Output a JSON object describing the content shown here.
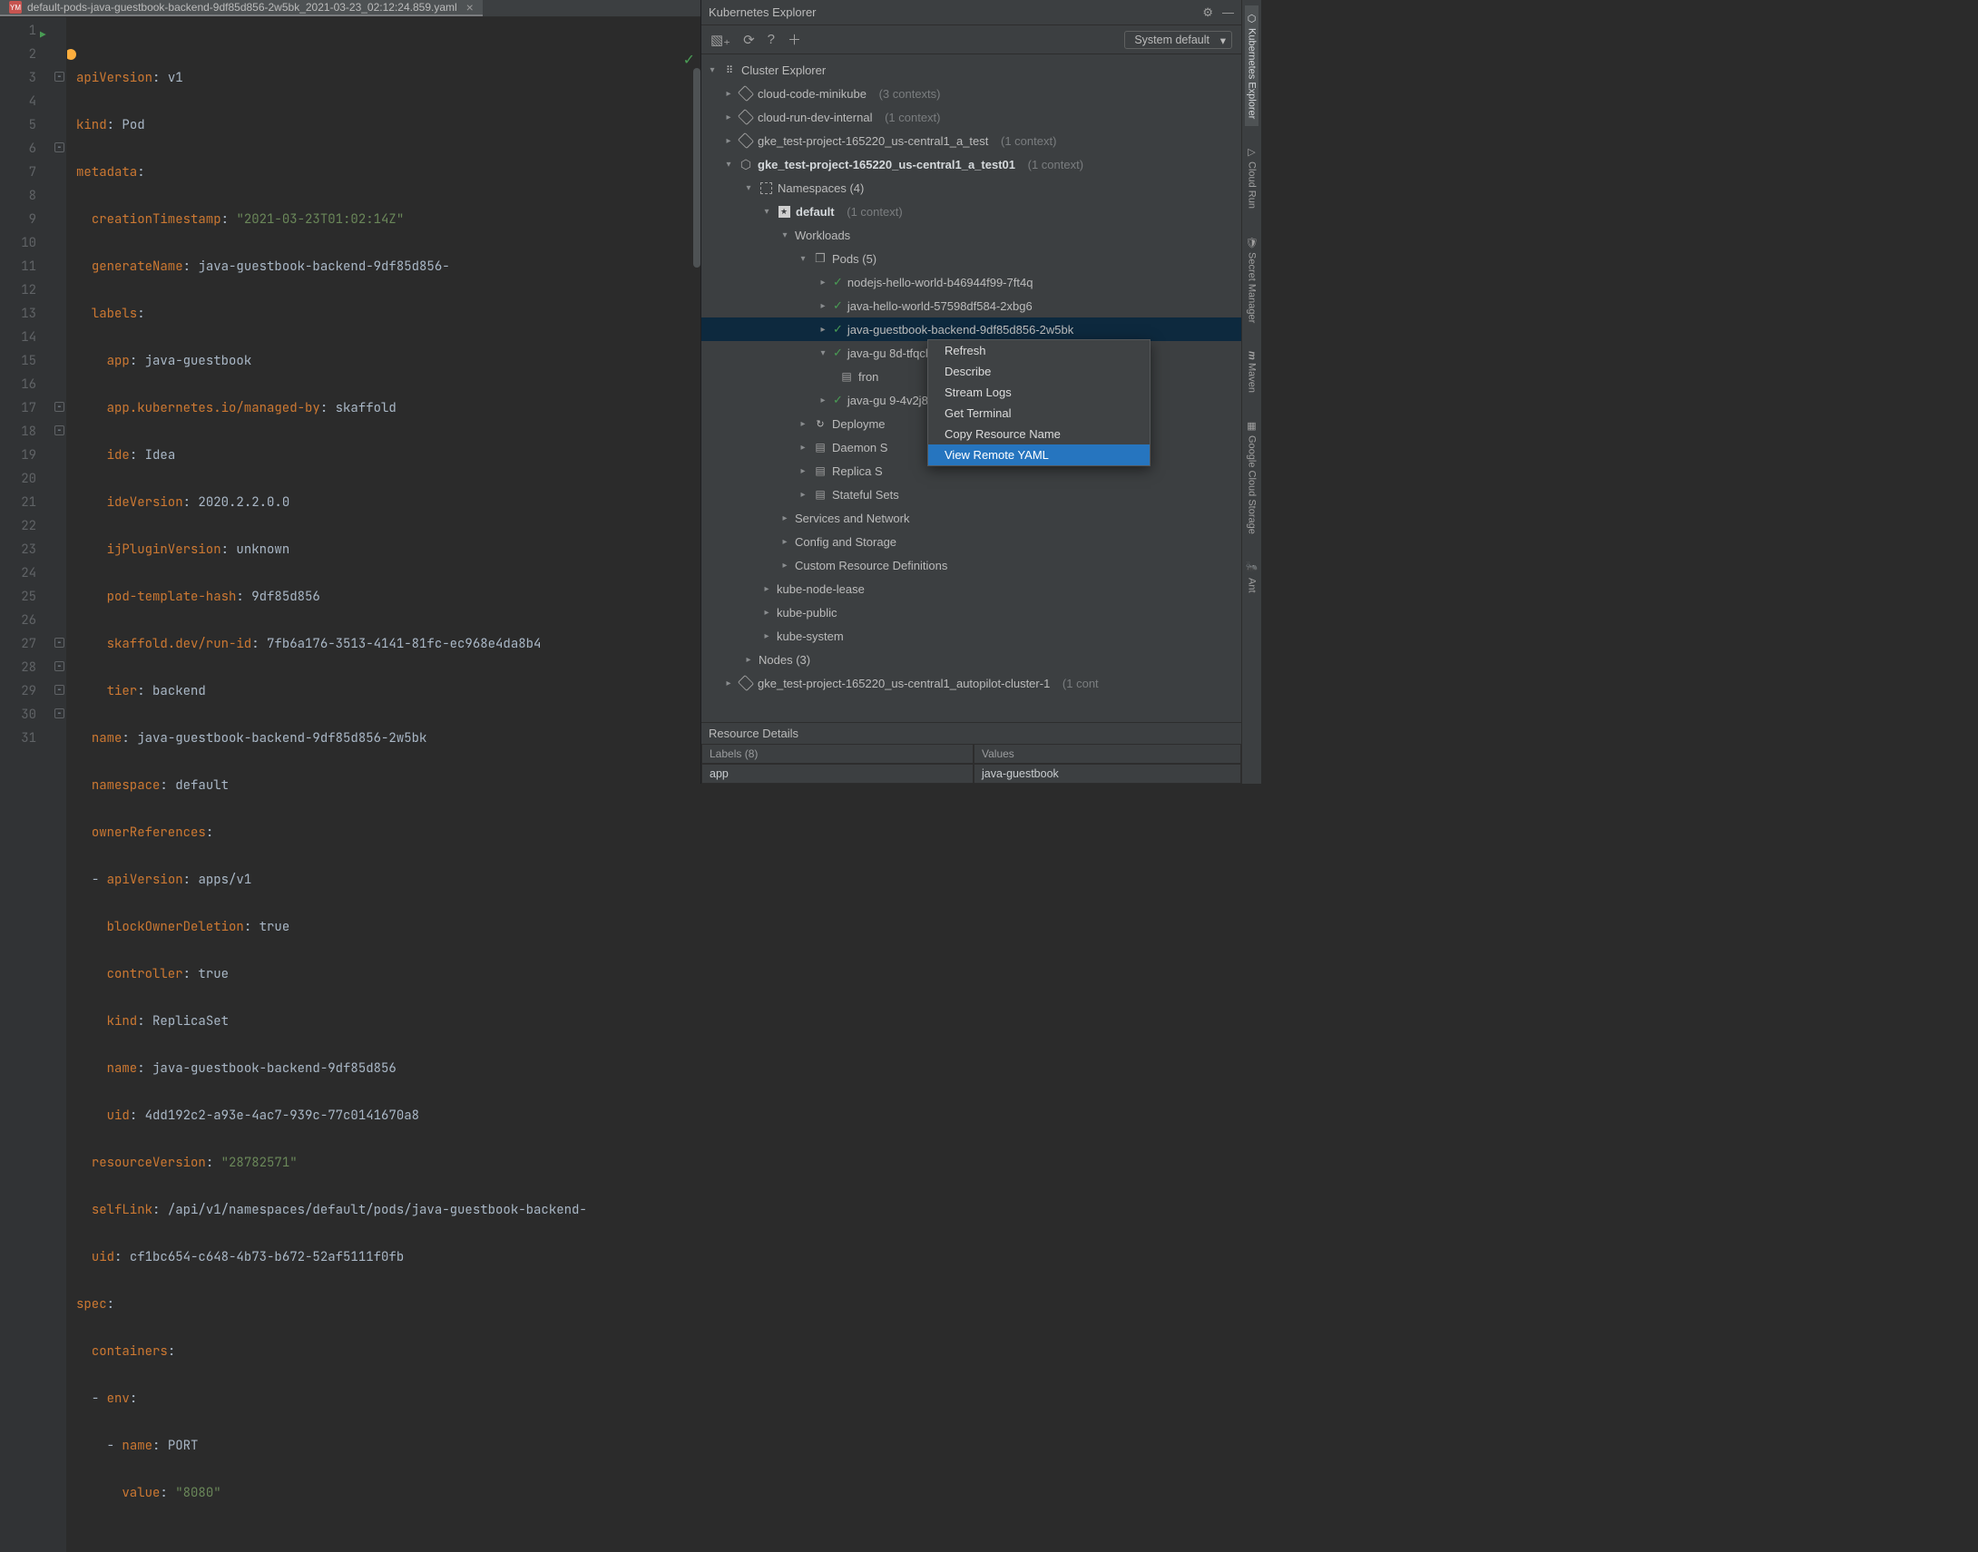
{
  "tab": {
    "filename": "default-pods-java-guestbook-backend-9df85d856-2w5bk_2021-03-23_02:12:24.859.yaml",
    "icon_label": "YM"
  },
  "gutter_lines": [
    "1",
    "2",
    "3",
    "4",
    "5",
    "6",
    "7",
    "8",
    "9",
    "10",
    "11",
    "12",
    "13",
    "14",
    "15",
    "16",
    "17",
    "18",
    "19",
    "20",
    "21",
    "22",
    "23",
    "24",
    "25",
    "26",
    "27",
    "28",
    "29",
    "30",
    "31"
  ],
  "code": {
    "l1_k": "apiVersion",
    "l1_v": "v1",
    "l2_k": "kind",
    "l2_v": "Pod",
    "l3_k": "metadata",
    "l4_k": "creationTimestamp",
    "l4_v": "\"2021-03-23T01:02:14Z\"",
    "l5_k": "generateName",
    "l5_v": "java-guestbook-backend-9df85d856-",
    "l6_k": "labels",
    "l7_k": "app",
    "l7_v": "java-guestbook",
    "l8_k": "app.kubernetes.io/managed-by",
    "l8_v": "skaffold",
    "l9_k": "ide",
    "l9_v": "Idea",
    "l10_k": "ideVersion",
    "l10_v": "2020.2.2.0.0",
    "l11_k": "ijPluginVersion",
    "l11_v": "unknown",
    "l12_k": "pod-template-hash",
    "l12_v": "9df85d856",
    "l13_k": "skaffold.dev/run-id",
    "l13_v": "7fb6a176-3513-4141-81fc-ec968e4da8b4",
    "l14_k": "tier",
    "l14_v": "backend",
    "l15_k": "name",
    "l15_v": "java-guestbook-backend-9df85d856-2w5bk",
    "l16_k": "namespace",
    "l16_v": "default",
    "l17_k": "ownerReferences",
    "l18_k": "apiVersion",
    "l18_v": "apps/v1",
    "l19_k": "blockOwnerDeletion",
    "l19_v": "true",
    "l20_k": "controller",
    "l20_v": "true",
    "l21_k": "kind",
    "l21_v": "ReplicaSet",
    "l22_k": "name",
    "l22_v": "java-guestbook-backend-9df85d856",
    "l23_k": "uid",
    "l23_v": "4dd192c2-a93e-4ac7-939c-77c0141670a8",
    "l24_k": "resourceVersion",
    "l24_v": "\"28782571\"",
    "l25_k": "selfLink",
    "l25_v": "/api/v1/namespaces/default/pods/java-guestbook-backend-",
    "l26_k": "uid",
    "l26_v": "cf1bc654-c648-4b73-b672-52af5111f0fb",
    "l27_k": "spec",
    "l28_k": "containers",
    "l29_k": "env",
    "l30_k": "name",
    "l30_v": "PORT",
    "l31_k": "value",
    "l31_v": "\"8080\""
  },
  "explorer": {
    "title": "Kubernetes Explorer",
    "dropdown": "System default",
    "root": "Cluster Explorer",
    "clusters": [
      {
        "name": "cloud-code-minikube",
        "ctx": "(3 contexts)"
      },
      {
        "name": "cloud-run-dev-internal",
        "ctx": "(1 context)"
      },
      {
        "name": "gke_test-project-165220_us-central1_a_test",
        "ctx": "(1 context)"
      }
    ],
    "activeCluster": {
      "name": "gke_test-project-165220_us-central1_a_test01",
      "ctx": "(1 context)"
    },
    "namespaces_label": "Namespaces (4)",
    "default_ns": "default",
    "default_ctx": "(1 context)",
    "workloads": "Workloads",
    "pods_label": "Pods (5)",
    "pods": [
      "nodejs-hello-world-b46944f99-7ft4q",
      "java-hello-world-57598df584-2xbg6",
      "java-guestbook-backend-9df85d856-2w5bk",
      "java-gu                               8d-tfqcb",
      "fron",
      "java-gu                               9-4v2j8"
    ],
    "after_pods": [
      "Deployme",
      "Daemon S",
      "Replica S",
      "Stateful Sets"
    ],
    "groups": [
      "Services and Network",
      "Config and Storage",
      "Custom Resource Definitions"
    ],
    "other_ns": [
      "kube-node-lease",
      "kube-public",
      "kube-system"
    ],
    "nodes_label": "Nodes (3)",
    "autopilot": {
      "name": "gke_test-project-165220_us-central1_autopilot-cluster-1",
      "ctx": "(1 cont"
    }
  },
  "context_menu": [
    "Refresh",
    "Describe",
    "Stream Logs",
    "Get Terminal",
    "Copy Resource Name",
    "View Remote YAML"
  ],
  "details": {
    "title": "Resource Details",
    "labels_hdr": "Labels (8)",
    "values_hdr": "Values",
    "row_key": "app",
    "row_val": "java-guestbook"
  },
  "toolstrip": [
    "Kubernetes Explorer",
    "Cloud Run",
    "Secret Manager",
    "Maven",
    "Google Cloud Storage",
    "Ant"
  ]
}
